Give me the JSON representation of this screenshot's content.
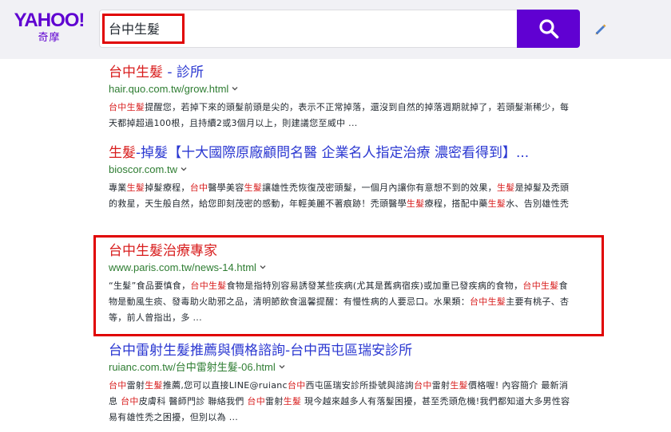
{
  "brand": {
    "logo_text": "YAHOO!",
    "logo_sub": "奇摩",
    "color": "#5f01d1"
  },
  "search": {
    "query": "台中生髮",
    "button_icon": "search-icon",
    "edit_icon": "pencil-icon"
  },
  "results": [
    {
      "title_parts": [
        {
          "text": "台中生髮",
          "hl": true
        },
        {
          "text": " - 診所",
          "hl": false
        }
      ],
      "url": "hair.quo.com.tw/grow.html",
      "desc_parts": [
        {
          "text": "台中生髮",
          "hl": true
        },
        {
          "text": "提醒您，若掉下來的頭髮前頭是尖的，表示不正常掉落，還沒到自然的掉落週期就掉了，若頭髮漸稀少，每天都掉超過100根，且持續2或3個月以上，則建議您至威中 ...",
          "hl": false
        }
      ]
    },
    {
      "title_parts": [
        {
          "text": "生髮",
          "hl": true
        },
        {
          "text": "-掉髮【十大國際原廠顧問名醫 企業名人指定治療 濃密看得到】...",
          "hl": false
        }
      ],
      "url": "bioscor.com.tw",
      "desc_parts": [
        {
          "text": "專業",
          "hl": false
        },
        {
          "text": "生髮",
          "hl": true
        },
        {
          "text": "掉髮療程，",
          "hl": false
        },
        {
          "text": "台中",
          "hl": true
        },
        {
          "text": "醫學美容",
          "hl": false
        },
        {
          "text": "生髮",
          "hl": true
        },
        {
          "text": "讓雄性禿恢復茂密頭髮，一個月內讓你有意想不到的效果，",
          "hl": false
        },
        {
          "text": "生髮",
          "hl": true
        },
        {
          "text": "是掉髮及禿頭的救星，天生般自然，給您即刻茂密的感動，年輕美麗不著痕跡！禿頭醫學",
          "hl": false
        },
        {
          "text": "生髮",
          "hl": true
        },
        {
          "text": "療程，搭配中藥",
          "hl": false
        },
        {
          "text": "生髮",
          "hl": true
        },
        {
          "text": "水、告別雄性禿",
          "hl": false
        }
      ]
    },
    {
      "title_parts": [
        {
          "text": "台中生髮",
          "hl": true
        },
        {
          "text": "治療專家",
          "hl": true
        }
      ],
      "url": "www.paris.com.tw/news-14.html",
      "desc_parts": [
        {
          "text": "“生髮”食品要慎食，",
          "hl": false
        },
        {
          "text": "台中生髮",
          "hl": true
        },
        {
          "text": "食物是指特別容易誘發某些疾病(尤其是舊病宿疾)或加重已發疾病的食物，",
          "hl": false
        },
        {
          "text": "台中生髮",
          "hl": true
        },
        {
          "text": "食物是動風生痰、發毒助火助邪之品，清明節飲食溫馨提醒：有慢性病的人要忌口。水果類：",
          "hl": false
        },
        {
          "text": "台中生髮",
          "hl": true
        },
        {
          "text": "主要有桃子、杏等，前人曾指出，多 ...",
          "hl": false
        }
      ]
    },
    {
      "title_parts": [
        {
          "text": "台中雷射生髮推薦與價格諮詢-台中西屯區瑞安診所",
          "hl": false
        }
      ],
      "url": "ruianc.com.tw/台中雷射生髮-06.html",
      "desc_parts": [
        {
          "text": "台中",
          "hl": true
        },
        {
          "text": "雷射",
          "hl": false
        },
        {
          "text": "生髮",
          "hl": true
        },
        {
          "text": "推薦,您可以直接LINE@ruianc",
          "hl": false
        },
        {
          "text": "台中",
          "hl": true
        },
        {
          "text": "西屯區瑞安診所掛號與諮詢",
          "hl": false
        },
        {
          "text": "台中",
          "hl": true
        },
        {
          "text": "雷射",
          "hl": false
        },
        {
          "text": "生髮",
          "hl": true
        },
        {
          "text": "價格喔! 內容簡介 最新消息 ",
          "hl": false
        },
        {
          "text": "台中",
          "hl": true
        },
        {
          "text": "皮膚科 醫師門診 聯絡我們 ",
          "hl": false
        },
        {
          "text": "台中",
          "hl": true
        },
        {
          "text": "雷射",
          "hl": false
        },
        {
          "text": "生髮",
          "hl": true
        },
        {
          "text": " 現今越來越多人有落髮困擾，甚至禿頭危機!我們都知道大多男性容易有雄性禿之困擾，但別以為 ...",
          "hl": false
        }
      ]
    }
  ]
}
